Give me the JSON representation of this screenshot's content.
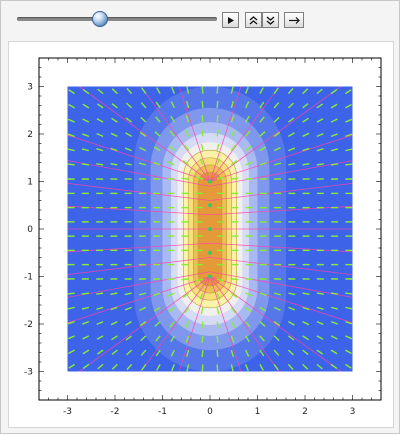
{
  "controls": {
    "slider_value": 0.44,
    "play_icon": "play-icon",
    "speed_up_icon": "double-chevron-up-icon",
    "speed_down_icon": "double-chevron-down-icon",
    "step_icon": "right-arrow-icon"
  },
  "plot": {
    "x_ticks": [
      "-3",
      "-2",
      "-1",
      "0",
      "1",
      "2",
      "3"
    ],
    "y_ticks": [
      "3",
      "2",
      "1",
      "0",
      "-1",
      "-2",
      "-3"
    ],
    "x_range": [
      -3.6,
      3.6
    ],
    "y_range": [
      -3.6,
      3.6
    ],
    "colors": {
      "background_field": "#3c63e8",
      "contour_levels": [
        "#5577ea",
        "#7f98ee",
        "#a9b9f2",
        "#d6dcf6",
        "#f2f0ea",
        "#fdf3a8",
        "#f7e07a",
        "#eebf55",
        "#e59a3a"
      ],
      "field_arrows": "#88ee33",
      "field_lines": "#ff44aa",
      "charge_markers": "#33cc66"
    }
  }
}
